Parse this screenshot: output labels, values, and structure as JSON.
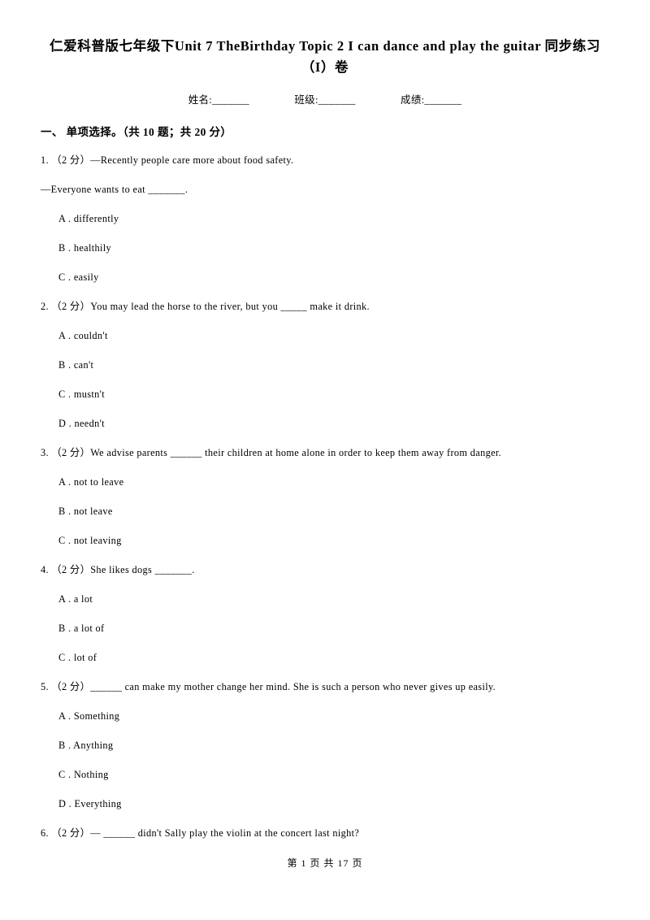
{
  "document": {
    "title": "仁爱科普版七年级下Unit 7 TheBirthday Topic 2 I can dance and play the guitar 同步练习（I）卷",
    "info_fields": [
      "姓名:_______",
      "班级:_______",
      "成绩:_______"
    ],
    "section_heading": "一、 单项选择。（共 10 题；共 20 分）",
    "questions": [
      {
        "stem": "1. （2 分）—Recently people care more about food safety.",
        "stem2": "—Everyone wants to eat _______.",
        "options": [
          "A . differently",
          "B . healthily",
          "C . easily"
        ]
      },
      {
        "stem": "2. （2 分）You may lead the horse to the river, but you _____ make it drink.",
        "options": [
          "A . couldn't",
          "B . can't",
          "C . mustn't",
          "D . needn't"
        ]
      },
      {
        "stem": "3. （2 分）We advise parents ______ their children at home alone in order to keep them away from danger.",
        "options": [
          "A . not to leave",
          "B . not leave",
          "C . not leaving"
        ]
      },
      {
        "stem": "4. （2 分）She likes dogs _______.",
        "options": [
          "A . a lot",
          "B . a lot of",
          "C . lot of"
        ]
      },
      {
        "stem": "5. （2 分）______ can make my mother change her mind. She is such a person who never gives up easily.",
        "options": [
          "A . Something",
          "B . Anything",
          "C . Nothing",
          "D . Everything"
        ]
      },
      {
        "stem": "6. （2 分）— ______ didn't Sally play the violin at the concert last night?",
        "options": []
      }
    ],
    "footer": "第 1 页 共 17 页"
  }
}
